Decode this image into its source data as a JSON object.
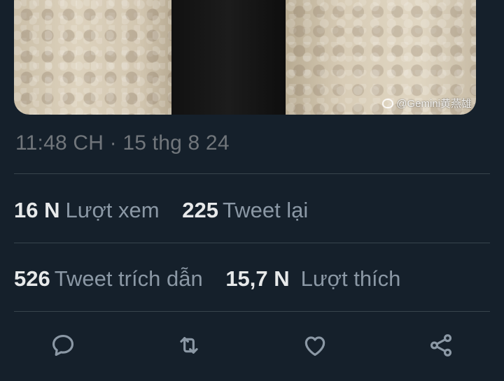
{
  "tweet": {
    "watermark": "@Gemini黄燕雄",
    "timestamp": "11:48 CH · 15 thg 8 24"
  },
  "stats": {
    "views": {
      "value": "16 N",
      "label": "Lượt xem"
    },
    "retweets": {
      "value": "225",
      "label": "Tweet lại"
    },
    "quotes": {
      "value": "526",
      "label": "Tweet trích dẫn"
    },
    "likes": {
      "value": "15,7 N",
      "label": "Lượt thích"
    }
  },
  "actions": [
    {
      "icon": "reply-icon"
    },
    {
      "icon": "retweet-icon"
    },
    {
      "icon": "like-icon"
    },
    {
      "icon": "share-icon"
    }
  ],
  "colors": {
    "background": "#15202b",
    "muted_text": "#71767b",
    "divider": "#38444d",
    "icon": "#8b98a5"
  }
}
